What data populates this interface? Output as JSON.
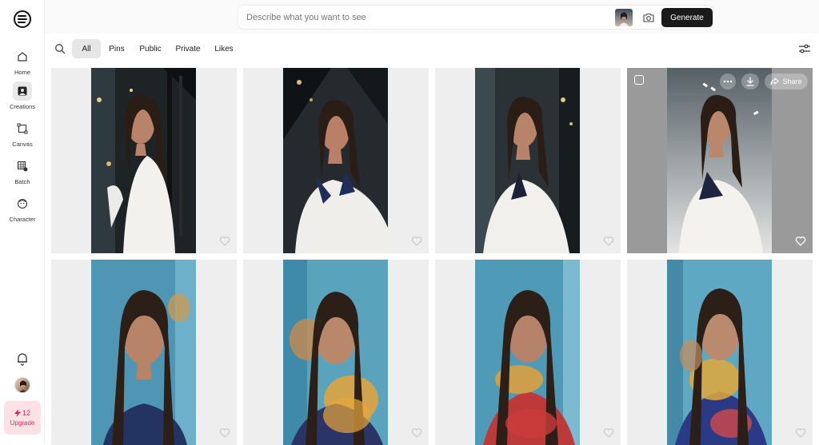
{
  "sidebar": {
    "items": [
      {
        "label": "Home",
        "icon": "home-icon"
      },
      {
        "label": "Creations",
        "icon": "creations-icon"
      },
      {
        "label": "Canvas",
        "icon": "canvas-icon"
      },
      {
        "label": "Batch",
        "icon": "batch-icon"
      },
      {
        "label": "Character",
        "icon": "character-icon"
      }
    ],
    "active": "Creations",
    "upgrade": {
      "credits": "12",
      "label": "Upgrade"
    }
  },
  "search": {
    "placeholder": "Describe what you want to see",
    "generate_label": "Generate"
  },
  "filters": {
    "tabs": [
      "All",
      "Pins",
      "Public",
      "Private",
      "Likes"
    ],
    "active": "All"
  },
  "hover_overlay": {
    "share_label": "Share",
    "more_icon": "more-icon",
    "download_icon": "download-icon",
    "share_icon": "share-icon"
  },
  "colors": {
    "accent_dark": "#1a1a1a",
    "upgrade_bg": "#fde1e6",
    "upgrade_text": "#e0245e",
    "card_bg": "#eeeeee"
  },
  "images": [
    {
      "scene": "dark-stair",
      "style": "white-dress"
    },
    {
      "scene": "dark-stair",
      "style": "white-dress"
    },
    {
      "scene": "dark-stair",
      "style": "white-dress"
    },
    {
      "scene": "light-fade",
      "style": "white-dress"
    },
    {
      "scene": "blue-sky",
      "style": "blazer"
    },
    {
      "scene": "blue-sky",
      "style": "blazer"
    },
    {
      "scene": "blue-sky",
      "style": "blazer"
    },
    {
      "scene": "blue-sky",
      "style": "blazer"
    }
  ]
}
